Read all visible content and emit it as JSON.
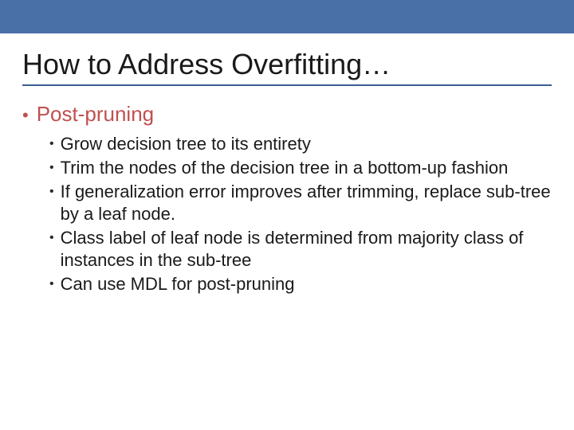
{
  "colors": {
    "header_bar": "#4a70a8",
    "accent": "#c05050",
    "text": "#1a1a1a",
    "rule": "#3b5e91"
  },
  "slide": {
    "title": "How to Address Overfitting…",
    "section": {
      "heading": "Post-pruning",
      "items": [
        "Grow decision tree to its entirety",
        "Trim the nodes of the decision tree in a bottom-up fashion",
        "If generalization error improves after trimming, replace sub-tree by a leaf node.",
        "Class label of leaf node is determined from majority class of instances in the sub-tree",
        "Can use MDL for post-pruning"
      ]
    }
  }
}
